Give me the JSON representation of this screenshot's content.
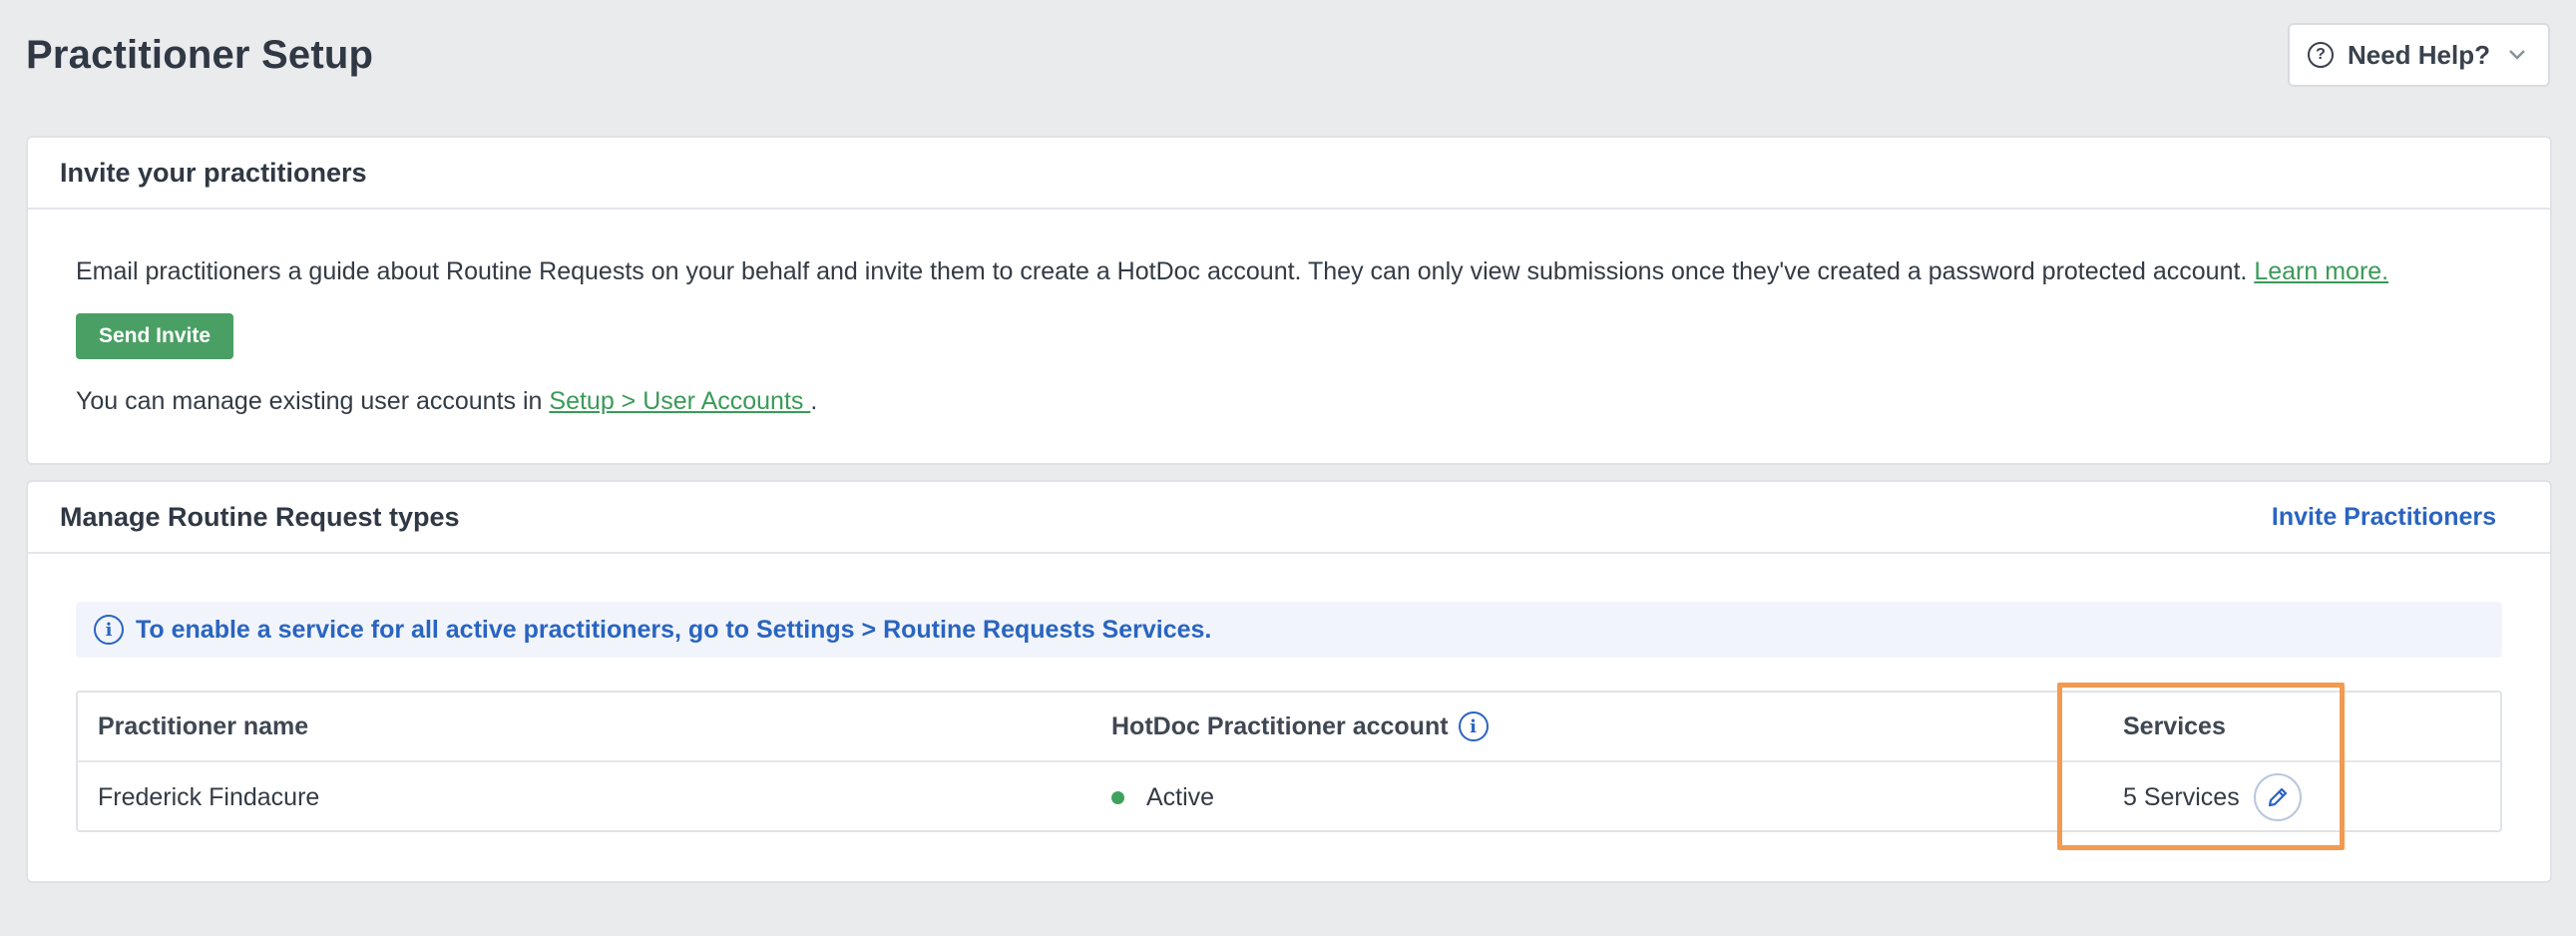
{
  "header": {
    "title": "Practitioner Setup",
    "help_label": "Need Help?",
    "help_icon": "question-circle-icon",
    "chevron_icon": "chevron-down-icon"
  },
  "invite_card": {
    "title": "Invite your practitioners",
    "description": "Email practitioners a guide about Routine Requests on your behalf and invite them to create a HotDoc account. They can only view submissions once they've created a password protected account. ",
    "learn_more_label": "Learn more.",
    "send_invite_label": "Send Invite",
    "manage_prefix": "You can manage existing user accounts in ",
    "manage_link_label": "Setup > User Accounts ",
    "manage_suffix": "."
  },
  "manage_card": {
    "title": "Manage Routine Request types",
    "invite_link_label": "Invite Practitioners",
    "info_banner": "To enable a service for all active practitioners, go to Settings > Routine Requests Services.",
    "table": {
      "columns": [
        "Practitioner name",
        "HotDoc Practitioner account",
        "Services"
      ],
      "rows": [
        {
          "name": "Frederick Findacure",
          "status": "Active",
          "services": "5 Services"
        }
      ]
    }
  },
  "colors": {
    "accent_blue": "#2a64c1",
    "accent_green": "#4aa064",
    "status_active": "#3ea25d",
    "highlight_orange": "#f39a4f"
  }
}
